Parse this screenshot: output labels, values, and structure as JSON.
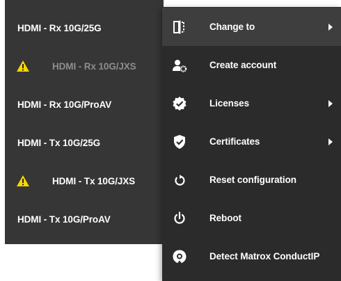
{
  "devices": [
    {
      "label": "HDMI - Rx 10G/25G",
      "warning": false,
      "dimmed": false
    },
    {
      "label": "HDMI - Rx 10G/JXS",
      "warning": true,
      "dimmed": true
    },
    {
      "label": "HDMI - Rx 10G/ProAV",
      "warning": false,
      "dimmed": false
    },
    {
      "label": "HDMI - Tx 10G/25G",
      "warning": false,
      "dimmed": false
    },
    {
      "label": "HDMI - Tx 10G/JXS",
      "warning": true,
      "dimmed": false
    },
    {
      "label": "HDMI - Tx 10G/ProAV",
      "warning": false,
      "dimmed": false
    }
  ],
  "context_menu": {
    "items": [
      {
        "label": "Change to",
        "icon": "change-to-icon",
        "submenu": true
      },
      {
        "label": "Create account",
        "icon": "user-gear-icon",
        "submenu": false
      },
      {
        "label": "Licenses",
        "icon": "verified-badge-icon",
        "submenu": true
      },
      {
        "label": "Certificates",
        "icon": "shield-check-icon",
        "submenu": true
      },
      {
        "label": "Reset configuration",
        "icon": "reset-icon",
        "submenu": false
      },
      {
        "label": "Reboot",
        "icon": "power-icon",
        "submenu": false
      },
      {
        "label": "Detect Matrox ConductIP",
        "icon": "detect-icon",
        "submenu": false
      }
    ]
  },
  "colors": {
    "panel_bg": "#363636",
    "menu_bg": "#2b2b2b",
    "menu_hover_bg": "#3e3e3e",
    "warning_yellow": "#f5d800",
    "text": "#ffffff",
    "text_dim": "#8e8e8e"
  }
}
